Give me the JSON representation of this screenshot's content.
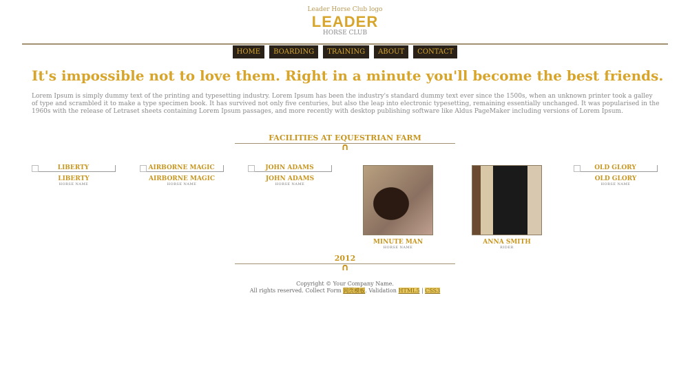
{
  "header": {
    "logo_alt": "Leader Horse Club logo",
    "brand": "LEADER",
    "subtitle": "HORSE CLUB"
  },
  "nav": [
    "HOME",
    "BOARDING",
    "TRAINING",
    "ABOUT",
    "CONTACT"
  ],
  "headline": "It's impossible not to love them. Right in a minute you'll become the best friends.",
  "intro": "Lorem Ipsum is simply dummy text of the printing and typesetting industry. Lorem Ipsum has been the industry's standard dummy text ever since the 1500s, when an unknown printer took a galley of type and scrambled it to make a type specimen book. It has survived not only five centuries, but also the leap into electronic typesetting, remaining essentially unchanged. It was popularised in the 1960s with the release of Letraset sheets containing Lorem Ipsum passages, and more recently with desktop publishing software like Aldus PageMaker including versions of Lorem Ipsum.",
  "section_title": "FACILITIES AT EQUESTRIAN FARM",
  "cards": [
    {
      "alt": "LIBERTY",
      "name": "LIBERTY",
      "role": "HORSE NAME"
    },
    {
      "alt": "AIRBORNE MAGIC",
      "name": "AIRBORNE MAGIC",
      "role": "HORSE NAME"
    },
    {
      "alt": "JOHN ADAMS",
      "name": "JOHN ADAMS",
      "role": "HORSE NAME"
    },
    {
      "name": "MINUTE MAN",
      "role": "HORSE NAME"
    },
    {
      "name": "ANNA SMITH",
      "role": "RIDER"
    },
    {
      "alt": "OLD GLORY",
      "name": "OLD GLORY",
      "role": "HORSE NAME"
    }
  ],
  "year": "2012",
  "footer": {
    "line1": "Copyright © Your Company Name.",
    "line2": "All rights reserved. Collect Form",
    "link1": "网页模板",
    "mid": ". Validation",
    "html5": "HTML5",
    "sep": " | ",
    "css3": "CSS3"
  }
}
